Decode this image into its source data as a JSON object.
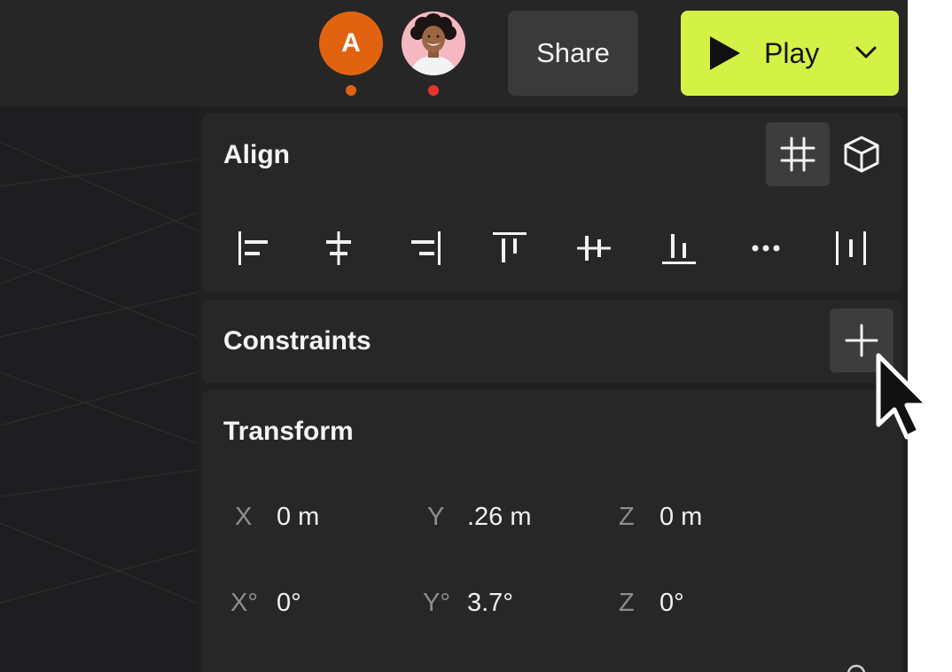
{
  "header": {
    "collaborators": [
      {
        "initial": "A",
        "color": "#e2630f",
        "status_color": "#e2630f"
      },
      {
        "type": "photo",
        "status_color": "#e8342c"
      }
    ],
    "share_label": "Share",
    "play_label": "Play",
    "accent_color": "#d3f245"
  },
  "align": {
    "title": "Align",
    "view_modes": [
      "grid-icon",
      "cube-icon"
    ],
    "tools": [
      "align-left-icon",
      "align-horizontal-center-icon",
      "align-right-icon",
      "align-top-icon",
      "align-vertical-center-icon",
      "align-bottom-icon",
      "more-icon",
      "distribute-icon"
    ]
  },
  "constraints": {
    "title": "Constraints"
  },
  "transform": {
    "title": "Transform",
    "position": {
      "x_label": "X",
      "x_value": "0 m",
      "y_label": "Y",
      "y_value": ".26 m",
      "z_label": "Z",
      "z_value": "0 m"
    },
    "rotation": {
      "x_label": "X°",
      "x_value": "0°",
      "y_label": "Y°",
      "y_value": "3.7°",
      "z_label": "Z",
      "z_value": "0°"
    }
  }
}
